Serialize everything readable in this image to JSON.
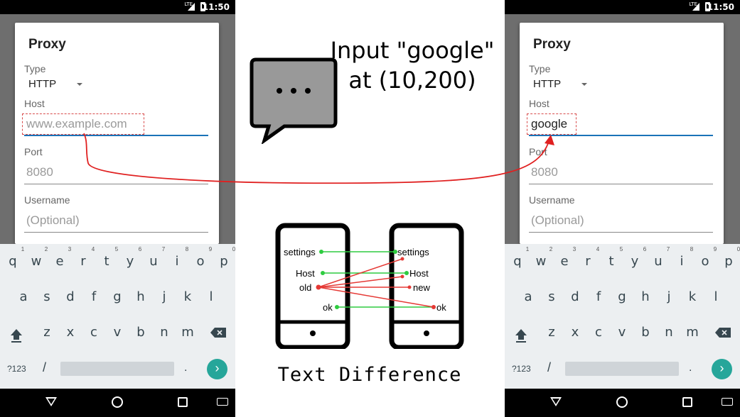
{
  "status_bar": {
    "time": "11:50",
    "network": "LTE"
  },
  "dialog": {
    "title": "Proxy",
    "type_label": "Type",
    "type_value": "HTTP",
    "host_label": "Host",
    "port_label": "Port",
    "port_placeholder": "8080",
    "username_label": "Username",
    "username_placeholder": "(Optional)"
  },
  "left_screen": {
    "host_placeholder": "www.example.com"
  },
  "right_screen": {
    "host_value": "google"
  },
  "keyboard": {
    "row1": [
      "q",
      "w",
      "e",
      "r",
      "t",
      "y",
      "u",
      "i",
      "o",
      "p"
    ],
    "row1_hints": [
      "1",
      "2",
      "3",
      "4",
      "5",
      "6",
      "7",
      "8",
      "9",
      "0"
    ],
    "row2": [
      "a",
      "s",
      "d",
      "f",
      "g",
      "h",
      "j",
      "k",
      "l"
    ],
    "row3": [
      "z",
      "x",
      "c",
      "v",
      "b",
      "n",
      "m"
    ],
    "symbols_key": "?123",
    "slash_key": "/",
    "period_key": "."
  },
  "annotation": {
    "instruction": "Input \"google\" at (10,200)",
    "caption": "Text Difference",
    "left_phone_labels": [
      "settings",
      "Host",
      "old",
      "ok"
    ],
    "right_phone_labels": [
      "settings",
      "Host",
      "new",
      "ok"
    ]
  },
  "colors": {
    "accent": "#1a73b8",
    "highlight": "#d84a4a",
    "enter": "#26a69a",
    "match_line": "#2ecc40",
    "diff_line": "#e53935"
  }
}
